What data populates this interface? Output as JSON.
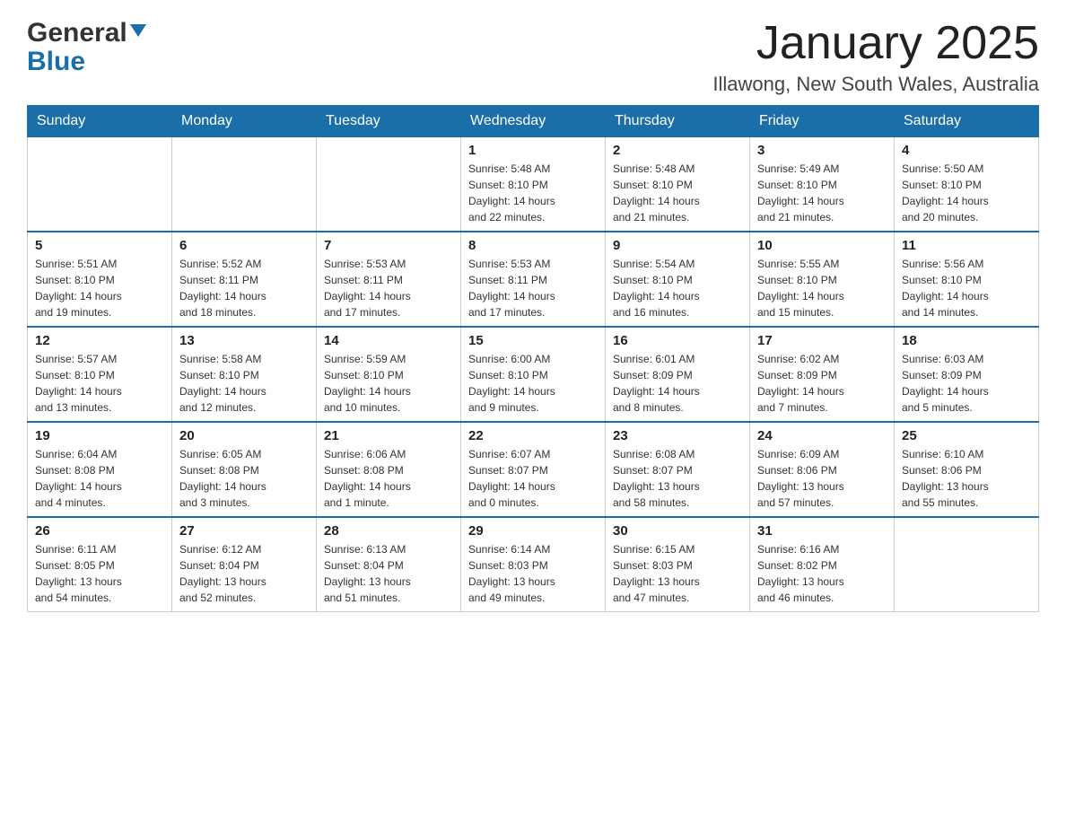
{
  "header": {
    "logo_general": "General",
    "logo_blue": "Blue",
    "month_title": "January 2025",
    "location": "Illawong, New South Wales, Australia"
  },
  "days_of_week": [
    "Sunday",
    "Monday",
    "Tuesday",
    "Wednesday",
    "Thursday",
    "Friday",
    "Saturday"
  ],
  "weeks": [
    [
      {
        "day": "",
        "info": ""
      },
      {
        "day": "",
        "info": ""
      },
      {
        "day": "",
        "info": ""
      },
      {
        "day": "1",
        "info": "Sunrise: 5:48 AM\nSunset: 8:10 PM\nDaylight: 14 hours\nand 22 minutes."
      },
      {
        "day": "2",
        "info": "Sunrise: 5:48 AM\nSunset: 8:10 PM\nDaylight: 14 hours\nand 21 minutes."
      },
      {
        "day": "3",
        "info": "Sunrise: 5:49 AM\nSunset: 8:10 PM\nDaylight: 14 hours\nand 21 minutes."
      },
      {
        "day": "4",
        "info": "Sunrise: 5:50 AM\nSunset: 8:10 PM\nDaylight: 14 hours\nand 20 minutes."
      }
    ],
    [
      {
        "day": "5",
        "info": "Sunrise: 5:51 AM\nSunset: 8:10 PM\nDaylight: 14 hours\nand 19 minutes."
      },
      {
        "day": "6",
        "info": "Sunrise: 5:52 AM\nSunset: 8:11 PM\nDaylight: 14 hours\nand 18 minutes."
      },
      {
        "day": "7",
        "info": "Sunrise: 5:53 AM\nSunset: 8:11 PM\nDaylight: 14 hours\nand 17 minutes."
      },
      {
        "day": "8",
        "info": "Sunrise: 5:53 AM\nSunset: 8:11 PM\nDaylight: 14 hours\nand 17 minutes."
      },
      {
        "day": "9",
        "info": "Sunrise: 5:54 AM\nSunset: 8:10 PM\nDaylight: 14 hours\nand 16 minutes."
      },
      {
        "day": "10",
        "info": "Sunrise: 5:55 AM\nSunset: 8:10 PM\nDaylight: 14 hours\nand 15 minutes."
      },
      {
        "day": "11",
        "info": "Sunrise: 5:56 AM\nSunset: 8:10 PM\nDaylight: 14 hours\nand 14 minutes."
      }
    ],
    [
      {
        "day": "12",
        "info": "Sunrise: 5:57 AM\nSunset: 8:10 PM\nDaylight: 14 hours\nand 13 minutes."
      },
      {
        "day": "13",
        "info": "Sunrise: 5:58 AM\nSunset: 8:10 PM\nDaylight: 14 hours\nand 12 minutes."
      },
      {
        "day": "14",
        "info": "Sunrise: 5:59 AM\nSunset: 8:10 PM\nDaylight: 14 hours\nand 10 minutes."
      },
      {
        "day": "15",
        "info": "Sunrise: 6:00 AM\nSunset: 8:10 PM\nDaylight: 14 hours\nand 9 minutes."
      },
      {
        "day": "16",
        "info": "Sunrise: 6:01 AM\nSunset: 8:09 PM\nDaylight: 14 hours\nand 8 minutes."
      },
      {
        "day": "17",
        "info": "Sunrise: 6:02 AM\nSunset: 8:09 PM\nDaylight: 14 hours\nand 7 minutes."
      },
      {
        "day": "18",
        "info": "Sunrise: 6:03 AM\nSunset: 8:09 PM\nDaylight: 14 hours\nand 5 minutes."
      }
    ],
    [
      {
        "day": "19",
        "info": "Sunrise: 6:04 AM\nSunset: 8:08 PM\nDaylight: 14 hours\nand 4 minutes."
      },
      {
        "day": "20",
        "info": "Sunrise: 6:05 AM\nSunset: 8:08 PM\nDaylight: 14 hours\nand 3 minutes."
      },
      {
        "day": "21",
        "info": "Sunrise: 6:06 AM\nSunset: 8:08 PM\nDaylight: 14 hours\nand 1 minute."
      },
      {
        "day": "22",
        "info": "Sunrise: 6:07 AM\nSunset: 8:07 PM\nDaylight: 14 hours\nand 0 minutes."
      },
      {
        "day": "23",
        "info": "Sunrise: 6:08 AM\nSunset: 8:07 PM\nDaylight: 13 hours\nand 58 minutes."
      },
      {
        "day": "24",
        "info": "Sunrise: 6:09 AM\nSunset: 8:06 PM\nDaylight: 13 hours\nand 57 minutes."
      },
      {
        "day": "25",
        "info": "Sunrise: 6:10 AM\nSunset: 8:06 PM\nDaylight: 13 hours\nand 55 minutes."
      }
    ],
    [
      {
        "day": "26",
        "info": "Sunrise: 6:11 AM\nSunset: 8:05 PM\nDaylight: 13 hours\nand 54 minutes."
      },
      {
        "day": "27",
        "info": "Sunrise: 6:12 AM\nSunset: 8:04 PM\nDaylight: 13 hours\nand 52 minutes."
      },
      {
        "day": "28",
        "info": "Sunrise: 6:13 AM\nSunset: 8:04 PM\nDaylight: 13 hours\nand 51 minutes."
      },
      {
        "day": "29",
        "info": "Sunrise: 6:14 AM\nSunset: 8:03 PM\nDaylight: 13 hours\nand 49 minutes."
      },
      {
        "day": "30",
        "info": "Sunrise: 6:15 AM\nSunset: 8:03 PM\nDaylight: 13 hours\nand 47 minutes."
      },
      {
        "day": "31",
        "info": "Sunrise: 6:16 AM\nSunset: 8:02 PM\nDaylight: 13 hours\nand 46 minutes."
      },
      {
        "day": "",
        "info": ""
      }
    ]
  ]
}
